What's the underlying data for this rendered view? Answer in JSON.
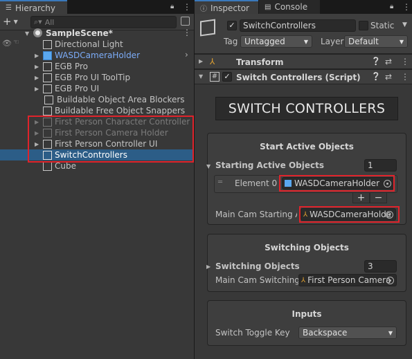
{
  "hierarchy": {
    "tab_label": "Hierarchy",
    "search_placeholder": "All",
    "add_label": "+",
    "scene_name": "SampleScene*",
    "items": [
      {
        "label": "Directional Light"
      },
      {
        "label": "WASDCameraHolder"
      },
      {
        "label": "EGB Pro"
      },
      {
        "label": "EGB Pro UI ToolTip"
      },
      {
        "label": "EGB Pro UI"
      },
      {
        "label": "Buildable Object Area Blockers"
      },
      {
        "label": "Buildable Free Object Snappers"
      },
      {
        "label": "First Person Character Controller"
      },
      {
        "label": "First Person Camera Holder"
      },
      {
        "label": "First Person Controller UI"
      },
      {
        "label": "SwitchControllers"
      },
      {
        "label": "Cube"
      }
    ]
  },
  "inspector": {
    "tab_label": "Inspector",
    "console_tab_label": "Console",
    "object_name": "SwitchControllers",
    "static_label": "Static",
    "tag_label": "Tag",
    "tag_value": "Untagged",
    "layer_label": "Layer",
    "layer_value": "Default",
    "transform_label": "Transform",
    "script_label": "Switch Controllers (Script)",
    "banner_title": "SWITCH CONTROLLERS",
    "start_section": {
      "title": "Start Active Objects",
      "list_label": "Starting Active Objects",
      "list_count": "1",
      "element_label": "Element 0",
      "element_value": "WASDCameraHolder",
      "plus": "+",
      "minus": "−",
      "main_cam_label": "Main Cam Starting Ac",
      "main_cam_value": "WASDCameraHolde"
    },
    "switching_section": {
      "title": "Switching Objects",
      "list_label": "Switching Objects",
      "list_count": "3",
      "main_cam_label": "Main Cam Switching",
      "main_cam_value": "First Person Camera"
    },
    "inputs_section": {
      "title": "Inputs",
      "toggle_label": "Switch Toggle Key",
      "toggle_value": "Backspace"
    }
  },
  "colors": {
    "selection": "#2c5d87",
    "highlight_box": "#e0232b",
    "prefab_blue": "#7cacf8"
  }
}
